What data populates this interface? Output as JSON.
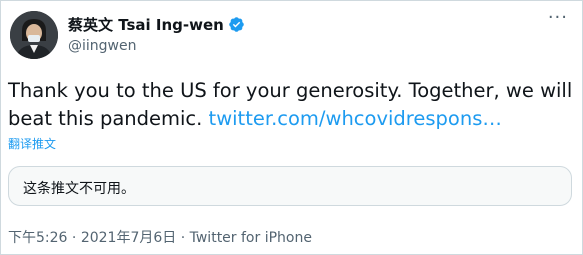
{
  "tweet": {
    "author": {
      "display_name": "蔡英文 Tsai Ing-wen",
      "handle": "@iingwen",
      "verified": true,
      "avatar": "profile-photo"
    },
    "more_icon": "more-options-icon",
    "text_plain": "Thank you to the US for your generosity. Together, we will beat this pandemic.",
    "link_text": "twitter.com/whcovidrespons…",
    "translate_label": "翻译推文",
    "quoted_unavailable": "这条推文不可用。",
    "time": "下午5:26",
    "separator": "·",
    "date": "2021年7月6日",
    "source": "Twitter for iPhone"
  },
  "colors": {
    "link": "#1d9bf0",
    "verified_badge": "#1d9bf0",
    "secondary_text": "#536471",
    "border": "#cfd9de"
  }
}
